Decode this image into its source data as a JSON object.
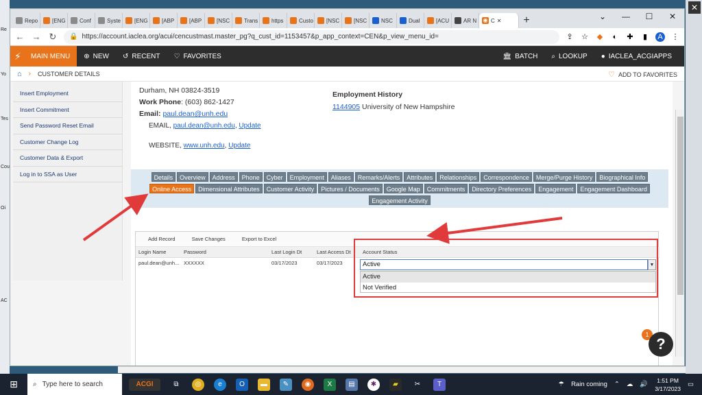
{
  "browser": {
    "tabs": [
      {
        "label": "Repo",
        "icon": "sheet-icon",
        "color": "#8a8a8a"
      },
      {
        "label": "[ENG",
        "icon": "acgi-icon",
        "color": "#e8731b"
      },
      {
        "label": "Conf",
        "icon": "sheet-icon",
        "color": "#8a8a8a"
      },
      {
        "label": "Syste",
        "icon": "sheet-icon",
        "color": "#8a8a8a"
      },
      {
        "label": "[ENG",
        "icon": "acgi-icon",
        "color": "#e8731b"
      },
      {
        "label": "[ABP",
        "icon": "acgi-icon",
        "color": "#e8731b"
      },
      {
        "label": "[ABP",
        "icon": "acgi-icon",
        "color": "#e8731b"
      },
      {
        "label": "[NSC",
        "icon": "acgi-icon",
        "color": "#e8731b"
      },
      {
        "label": "Trans",
        "icon": "acgi-icon",
        "color": "#e8731b"
      },
      {
        "label": "https",
        "icon": "acgi-icon",
        "color": "#e8731b"
      },
      {
        "label": "Custo",
        "icon": "acgi-icon",
        "color": "#e8731b"
      },
      {
        "label": "[NSC",
        "icon": "acgi-icon",
        "color": "#e8731b"
      },
      {
        "label": "[NSC",
        "icon": "acgi-icon",
        "color": "#e8731b"
      },
      {
        "label": "NSC",
        "icon": "butterfly-icon",
        "color": "#1a5fd0"
      },
      {
        "label": "Dual",
        "icon": "butterfly-icon",
        "color": "#1a5fd0"
      },
      {
        "label": "[ACU",
        "icon": "acgi-icon",
        "color": "#e8731b"
      },
      {
        "label": "AR N",
        "icon": "globe-icon",
        "color": "#444"
      }
    ],
    "active_tab": {
      "label": "C"
    },
    "url": "https://account.iaclea.org/acui/cencustmast.master_pg?q_cust_id=1153457&p_app_context=CEN&p_view_menu_id=",
    "avatar_letter": "A"
  },
  "appnav": {
    "main_menu": "MAIN MENU",
    "new": "NEW",
    "recent": "RECENT",
    "favorites": "FAVORITES",
    "batch": "BATCH",
    "lookup": "LOOKUP",
    "user": "IACLEA_ACGIAPPS"
  },
  "breadcrumb": {
    "current": "CUSTOMER DETAILS",
    "add_favorites": "ADD TO FAVORITES"
  },
  "sidebar": {
    "items": [
      "Insert Employment",
      "Insert Commitment",
      "Send Password Reset Email",
      "Customer Change Log",
      "Customer Data & Export",
      "Log in to SSA as User"
    ]
  },
  "customer": {
    "address_line": "Durham, NH 03824-3519",
    "work_phone_label": "Work Phone",
    "work_phone": ": (603) 862-1427",
    "email_label": "Email:",
    "email": "paul.dean@unh.edu",
    "email_row_prefix": "EMAIL,",
    "email_row_value": "paul.dean@unh.edu",
    "update_label": "Update",
    "website_prefix": "WEBSITE,",
    "website_value": "www.unh.edu",
    "employment_history_label": "Employment History",
    "employment_id": "1144905",
    "employment_org": "University of New Hampshire"
  },
  "detail_tabs": {
    "row1": [
      "Details",
      "Overview",
      "Address",
      "Phone",
      "Cyber",
      "Employment",
      "Aliases",
      "Remarks/Alerts",
      "Attributes",
      "Relationships",
      "Correspondence",
      "Merge/Purge History",
      "Biographical Info"
    ],
    "row2": [
      "Online Access",
      "Dimensional Attributes",
      "Customer Activity",
      "Pictures / Documents",
      "Google Map",
      "Commitments",
      "Directory Preferences",
      "Engagement",
      "Engagement Dashboard"
    ],
    "row3": [
      "Engagement Activity"
    ],
    "active": "Online Access"
  },
  "grid": {
    "toolbar": {
      "add": "Add Record",
      "save": "Save Changes",
      "export": "Export to Excel"
    },
    "columns": [
      "Login Name",
      "Password",
      "Last Login Dt",
      "Last Access Dt",
      "Account Status"
    ],
    "row": {
      "login": "paul.dean@unh...",
      "password": "XXXXXX",
      "last_login": "03/17/2023",
      "last_access": "03/17/2023",
      "status": "Active"
    },
    "status_options": [
      "Active",
      "Not Verified"
    ]
  },
  "help": {
    "badge": "1",
    "label": "?"
  },
  "taskbar": {
    "search_placeholder": "Type here to search",
    "weather": "Rain coming",
    "time": "1:51 PM",
    "date": "3/17/2023"
  },
  "colors": {
    "accent": "#e8731b",
    "annotation": "#e03a3a",
    "nav_bg": "#2d2d2d",
    "link": "#1a5fd0"
  }
}
